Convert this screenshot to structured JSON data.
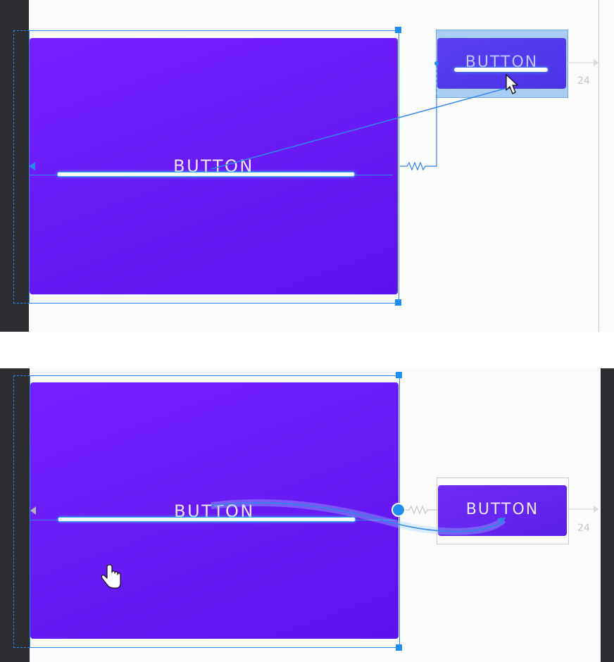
{
  "top_frame": {
    "main_button_label": "BUTTON",
    "side_button_label": "BUTTON",
    "margin_value": "24",
    "side_button_state": "selected",
    "cursor": "arrow-pointer-icon"
  },
  "bottom_frame": {
    "main_button_label": "BUTTON",
    "side_button_label": "BUTTON",
    "margin_value": "24",
    "side_button_state": "constrained",
    "cursor": "hand-pointer-icon"
  },
  "colors": {
    "button_purple": "#6a1cf5",
    "constraint_blue": "#2f86e8",
    "baseline_glow": "#3fb0ff",
    "editor_dark": "#2b2d31",
    "canvas_bg": "#fbfbfc"
  }
}
